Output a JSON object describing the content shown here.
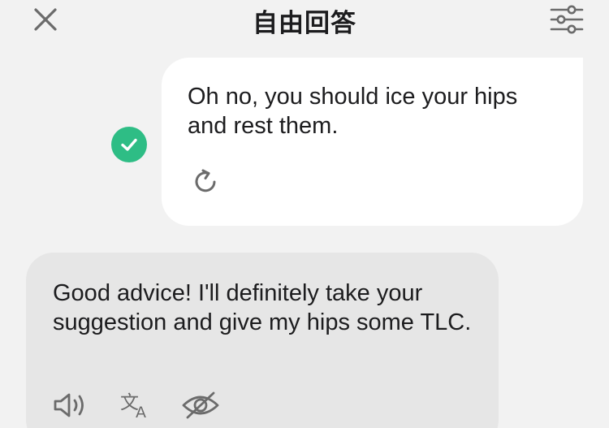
{
  "header": {
    "title": "自由回答",
    "close_icon": "close-icon",
    "settings_icon": "sliders-icon"
  },
  "messages": {
    "user": {
      "text": "Oh no, you should ice your hips and rest them.",
      "status_icon": "check-circle-icon",
      "retry_icon": "refresh-icon"
    },
    "bot": {
      "text": "Good advice! I'll definitely take your suggestion and give my hips some TLC.",
      "actions": {
        "speak_icon": "speaker-icon",
        "translate_icon": "translate-icon",
        "hide_icon": "eye-off-icon"
      }
    }
  },
  "colors": {
    "background": "#f2f2f2",
    "user_bubble": "#ffffff",
    "bot_bubble": "#e6e6e6",
    "success": "#2ebd85",
    "icon": "#6b6b6b",
    "text": "#1c1c1e"
  }
}
